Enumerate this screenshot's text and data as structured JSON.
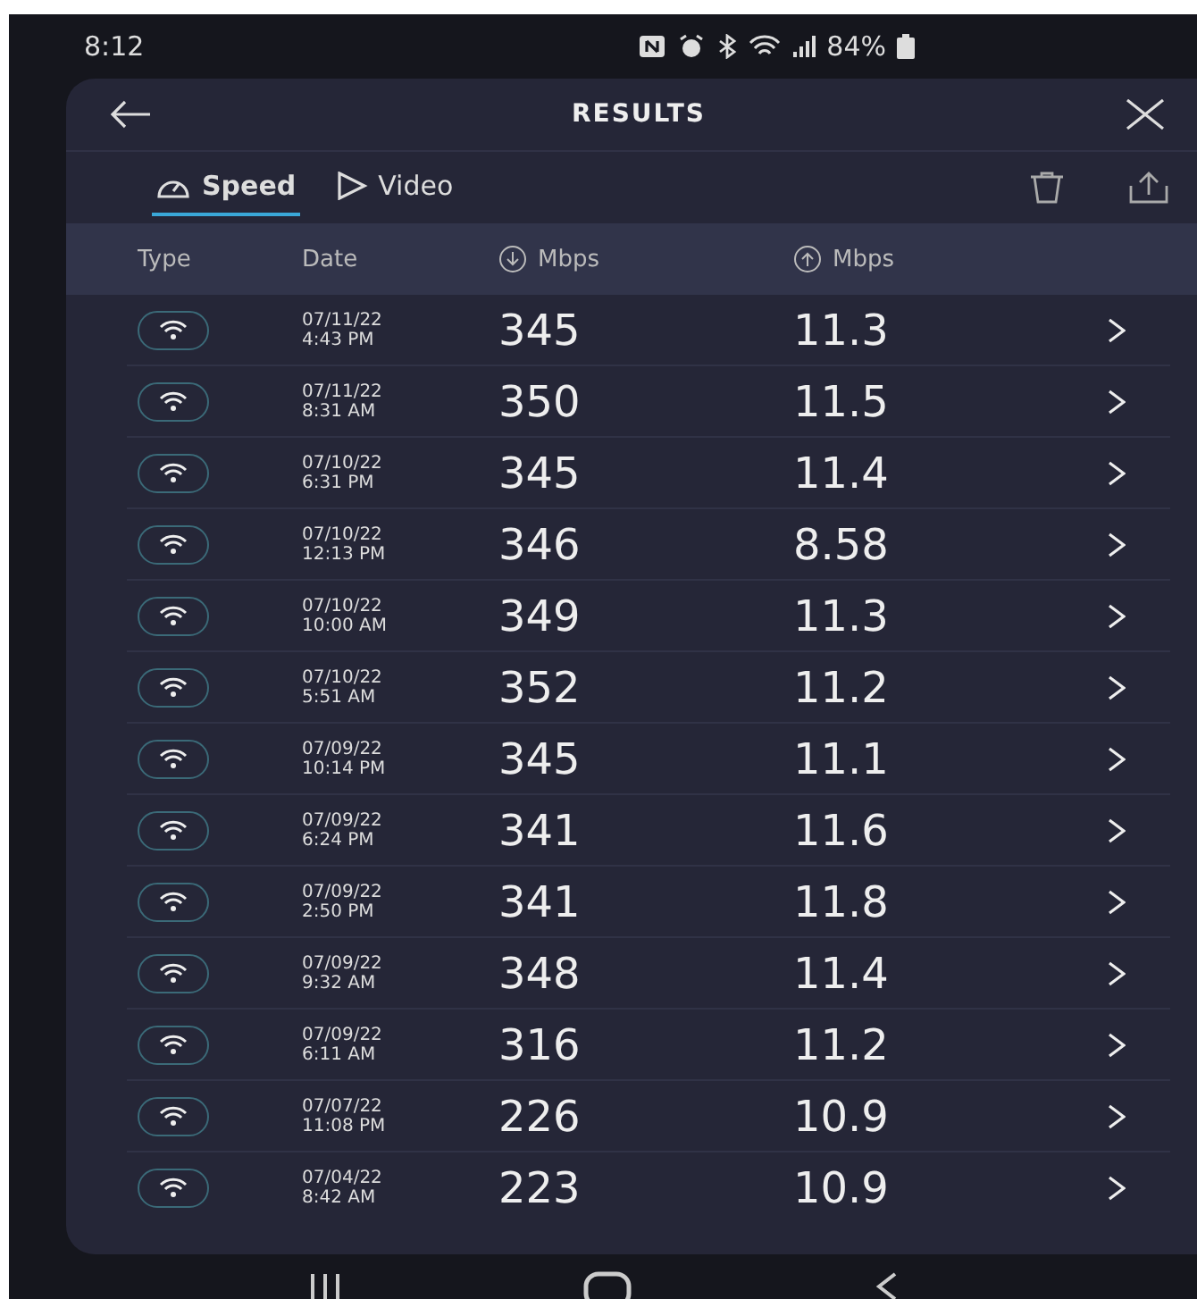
{
  "status_bar": {
    "time": "8:12",
    "battery": "84%"
  },
  "header": {
    "title": "RESULTS"
  },
  "tabs": [
    {
      "label": "Speed",
      "kind": "speed",
      "selected": true
    },
    {
      "label": "Video",
      "kind": "video",
      "selected": false
    }
  ],
  "table": {
    "columns": [
      "Type",
      "Date",
      "Mbps",
      "Mbps"
    ],
    "rows": [
      {
        "date": "07/11/22",
        "time": "4:43 PM",
        "download": "345",
        "upload": "11.3"
      },
      {
        "date": "07/11/22",
        "time": "8:31 AM",
        "download": "350",
        "upload": "11.5"
      },
      {
        "date": "07/10/22",
        "time": "6:31 PM",
        "download": "345",
        "upload": "11.4"
      },
      {
        "date": "07/10/22",
        "time": "12:13 PM",
        "download": "346",
        "upload": "8.58"
      },
      {
        "date": "07/10/22",
        "time": "10:00 AM",
        "download": "349",
        "upload": "11.3"
      },
      {
        "date": "07/10/22",
        "time": "5:51 AM",
        "download": "352",
        "upload": "11.2"
      },
      {
        "date": "07/09/22",
        "time": "10:14 PM",
        "download": "345",
        "upload": "11.1"
      },
      {
        "date": "07/09/22",
        "time": "6:24 PM",
        "download": "341",
        "upload": "11.6"
      },
      {
        "date": "07/09/22",
        "time": "2:50 PM",
        "download": "341",
        "upload": "11.8"
      },
      {
        "date": "07/09/22",
        "time": "9:32 AM",
        "download": "348",
        "upload": "11.4"
      },
      {
        "date": "07/09/22",
        "time": "6:11 AM",
        "download": "316",
        "upload": "11.2"
      },
      {
        "date": "07/07/22",
        "time": "11:08 PM",
        "download": "226",
        "upload": "10.9"
      },
      {
        "date": "07/04/22",
        "time": "8:42 AM",
        "download": "223",
        "upload": "10.9"
      }
    ]
  }
}
